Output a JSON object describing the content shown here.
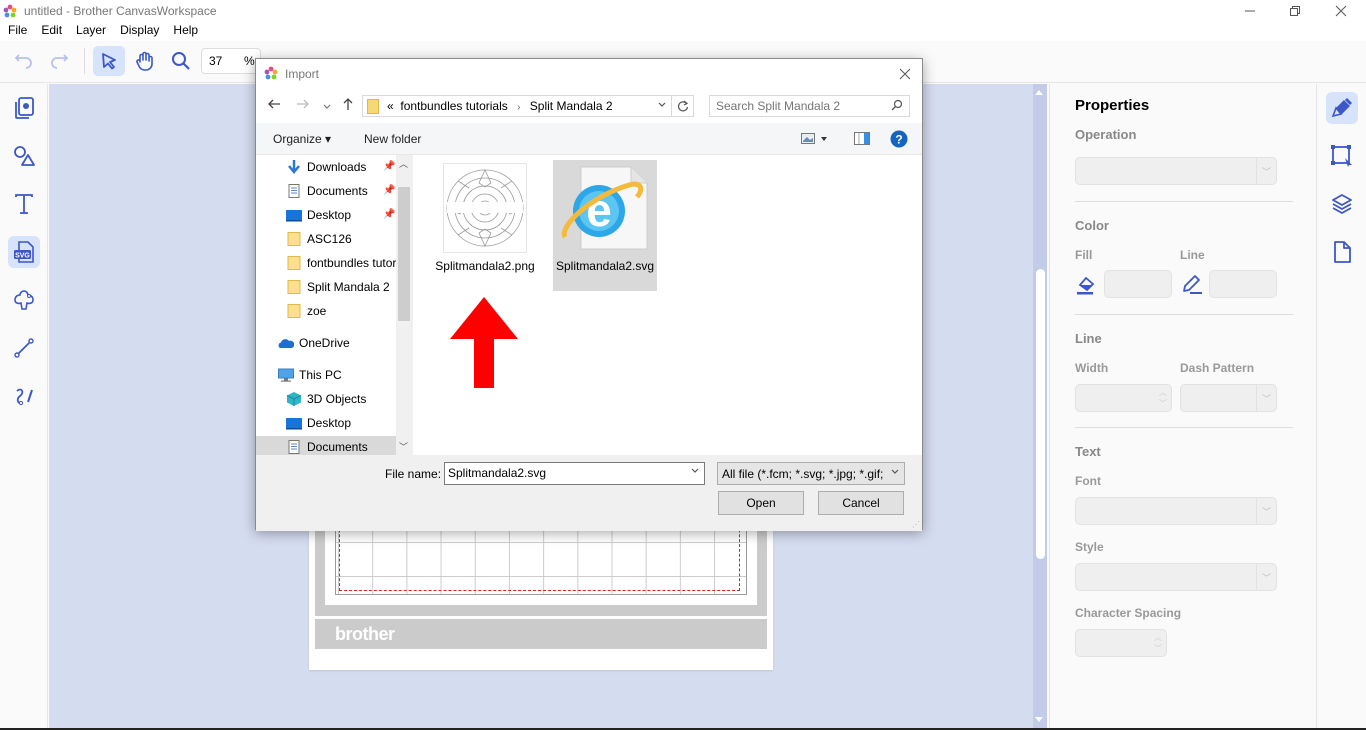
{
  "window": {
    "title": "untitled - Brother CanvasWorkspace",
    "controls": {
      "minimize": "—",
      "restore": "❐",
      "close": "✕"
    }
  },
  "menu": [
    "File",
    "Edit",
    "Layer",
    "Display",
    "Help"
  ],
  "toolbar": {
    "undo_icon": "undo-icon",
    "redo_icon": "redo-icon",
    "select_icon": "pointer-icon",
    "pan_icon": "hand-icon",
    "zoom_icon": "magnifier-icon",
    "zoom_value": "37",
    "zoom_unit": "%"
  },
  "left_tools": [
    {
      "name": "artwork-gallery",
      "icon": "book-icon",
      "active": false
    },
    {
      "name": "shapes",
      "icon": "shapes-icon",
      "active": false
    },
    {
      "name": "text",
      "icon": "text-icon",
      "active": false
    },
    {
      "name": "import-svg",
      "icon": "svg-file-icon",
      "label": "SVG",
      "active": true
    },
    {
      "name": "patterns",
      "icon": "spade-shape-icon",
      "active": false
    },
    {
      "name": "line",
      "icon": "line-icon",
      "active": false
    },
    {
      "name": "freehand",
      "icon": "freehand-icon",
      "active": false
    }
  ],
  "mat": {
    "brand": "brother"
  },
  "properties": {
    "title": "Properties",
    "operation_label": "Operation",
    "color_label": "Color",
    "fill_label": "Fill",
    "line_color_label": "Line",
    "line_section_label": "Line",
    "width_label": "Width",
    "dash_label": "Dash Pattern",
    "text_label": "Text",
    "font_label": "Font",
    "style_label": "Style",
    "char_spacing_label": "Character Spacing"
  },
  "right_rail": [
    "brush-icon",
    "transform-select-icon",
    "layers-icon",
    "page-icon"
  ],
  "dialog": {
    "title": "Import",
    "close": "✕",
    "address": {
      "prefix": "«",
      "crumbs": [
        "fontbundles tutorials",
        "Split Mandala 2"
      ]
    },
    "search_placeholder": "Search Split Mandala 2",
    "commands": {
      "organize": "Organize ▾",
      "new_folder": "New folder"
    },
    "nav_items": [
      {
        "label": "Downloads",
        "icon": "download-arrow-icon",
        "pinned": true
      },
      {
        "label": "Documents",
        "icon": "documents-icon",
        "pinned": true
      },
      {
        "label": "Desktop",
        "icon": "desktop-icon",
        "pinned": true
      },
      {
        "label": "ASC126",
        "icon": "folder-icon",
        "pinned": false
      },
      {
        "label": "fontbundles tutorials",
        "icon": "folder-icon",
        "pinned": false
      },
      {
        "label": "Split Mandala 2",
        "icon": "folder-icon",
        "pinned": false
      },
      {
        "label": "zoe",
        "icon": "folder-icon",
        "pinned": false
      },
      {
        "label": "OneDrive",
        "icon": "cloud-icon",
        "pinned": false
      },
      {
        "label": "This PC",
        "icon": "computer-icon",
        "pinned": false
      },
      {
        "label": "3D Objects",
        "icon": "cube-icon",
        "pinned": false
      },
      {
        "label": "Desktop",
        "icon": "desktop-icon",
        "pinned": false
      },
      {
        "label": "Documents",
        "icon": "documents-icon",
        "pinned": false,
        "selected": true
      }
    ],
    "files": [
      {
        "name": "Splitmandala2.png",
        "icon": "mandala-thumbnail-icon",
        "selected": false
      },
      {
        "name": "Splitmandala2.svg",
        "icon": "internet-explorer-icon",
        "selected": true
      }
    ],
    "annotation": "red-arrow-up",
    "file_name_label": "File name:",
    "file_name_value": "Splitmandala2.svg",
    "file_type": "All file (*.fcm; *.svg; *.jpg; *.gif;",
    "open_label": "Open",
    "cancel_label": "Cancel"
  }
}
